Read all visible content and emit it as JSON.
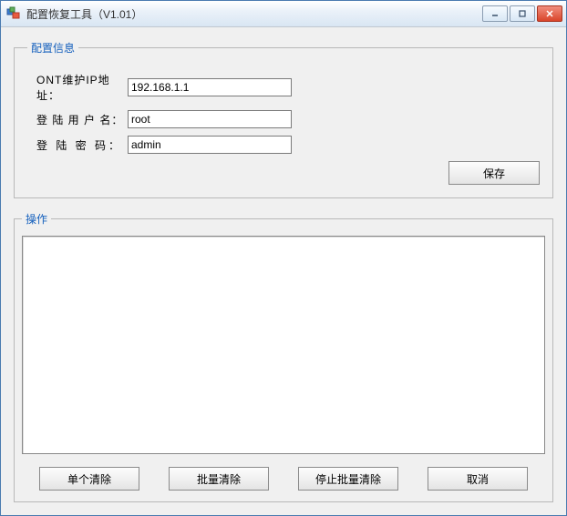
{
  "window": {
    "title": "配置恢复工具（V1.01）"
  },
  "config": {
    "legend": "配置信息",
    "ip_label": "ONT维护IP地址：",
    "ip_value": "192.168.1.1",
    "user_label": "登 陆 用 户 名：",
    "user_value": "root",
    "pwd_label": "登 陆 密 码：",
    "pwd_value": "admin",
    "save_label": "保存"
  },
  "ops": {
    "legend": "操作",
    "log_text": "",
    "btn_single": "单个清除",
    "btn_batch": "批量清除",
    "btn_stop": "停止批量清除",
    "btn_cancel": "取消"
  }
}
